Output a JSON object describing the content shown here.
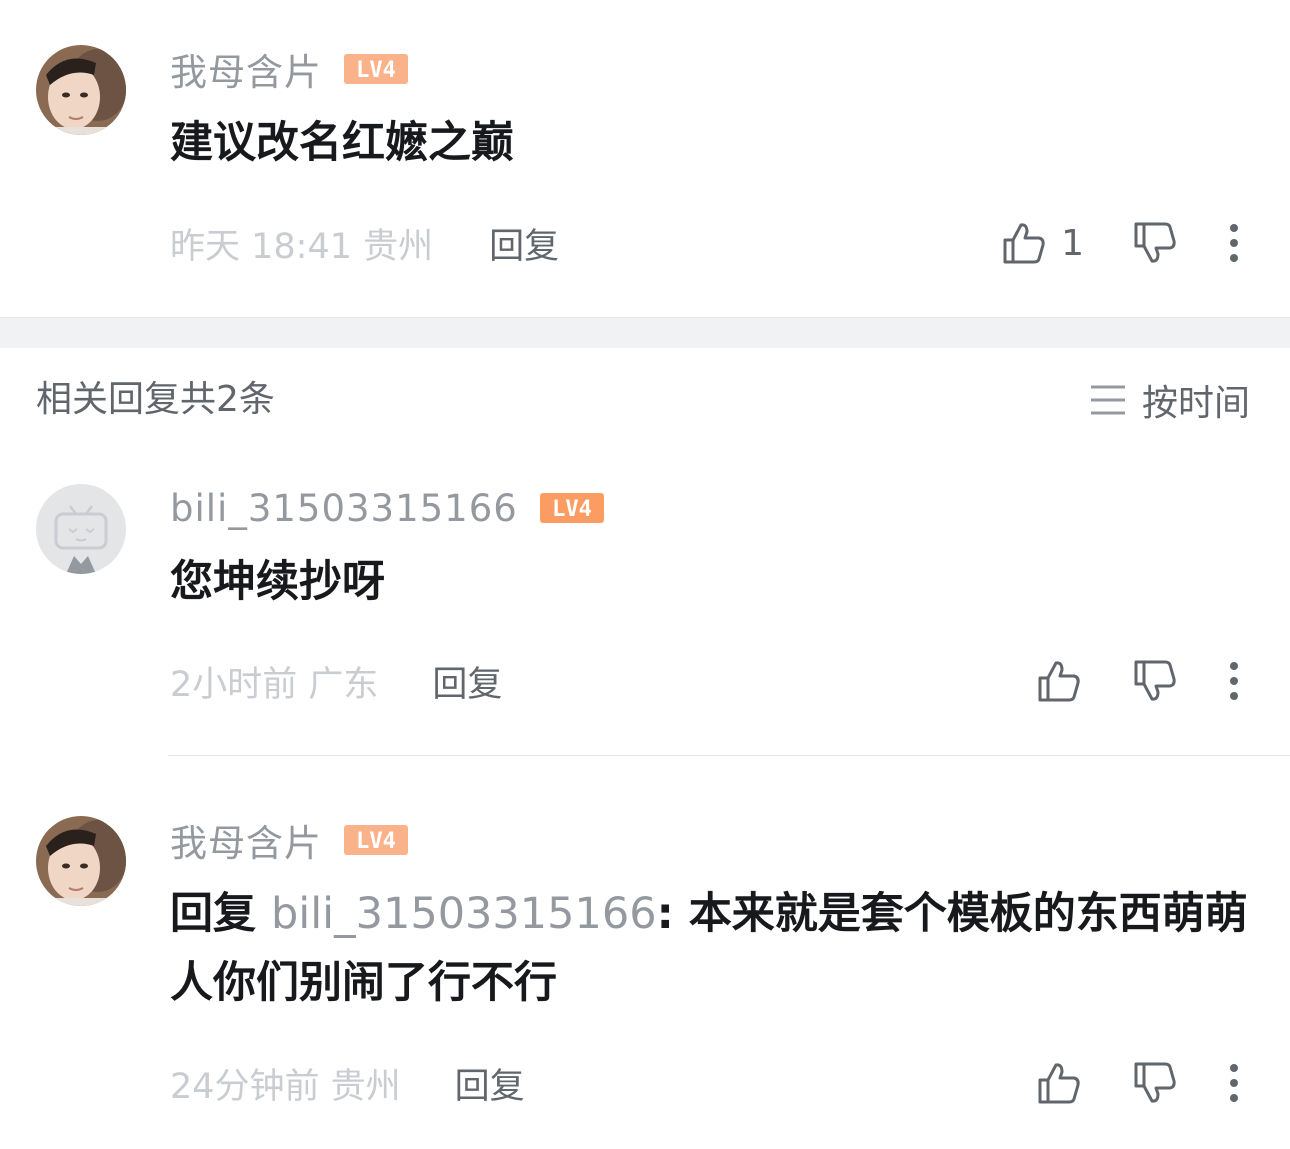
{
  "main_comment": {
    "username": "我母含片",
    "level": "LV4",
    "content": "建议改名红嬷之巅",
    "time_location": "昨天 18:41 贵州",
    "reply_label": "回复",
    "like_count": "1"
  },
  "replies_header": {
    "title": "相关回复共2条",
    "sort_label": "按时间"
  },
  "replies": [
    {
      "username": "bili_31503315166",
      "level": "LV4",
      "content": "您坤续抄呀",
      "time_location": "2小时前 广东",
      "reply_label": "回复"
    },
    {
      "username": "我母含片",
      "level": "LV4",
      "content_prefix": "回复 ",
      "mention": "bili_31503315166",
      "content_rest": ": 本来就是套个模板的东西萌萌人你们别闹了行不行",
      "time_location": "24分钟前 贵州",
      "reply_label": "回复"
    }
  ],
  "colors": {
    "level_badge": "#f9b28a",
    "level_badge_blue": "#fb9c63",
    "text_primary": "#18191c",
    "text_secondary": "#9499a0",
    "text_muted": "#c9ccd0",
    "divider": "#f1f2f3"
  },
  "icons": [
    "thumbs-up-icon",
    "thumbs-down-icon",
    "more-vertical-icon",
    "sort-lines-icon",
    "bilibili-tv-avatar-icon"
  ]
}
